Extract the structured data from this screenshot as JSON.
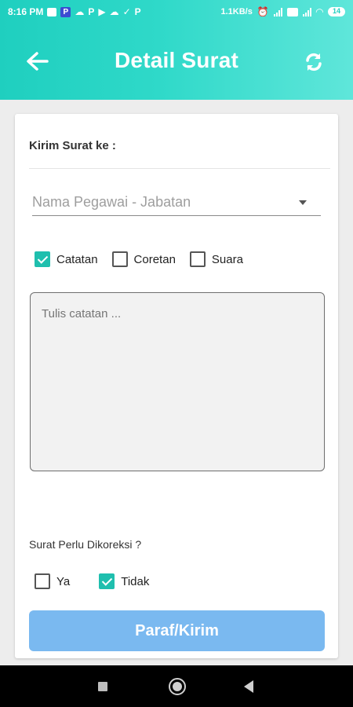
{
  "status_bar": {
    "time": "8:16 PM",
    "net_speed": "1.1KB/s",
    "battery": "14"
  },
  "app_bar": {
    "title": "Detail Surat",
    "back_icon": "arrow-left-icon",
    "refresh_icon": "refresh-icon"
  },
  "form": {
    "send_to_label": "Kirim Surat ke :",
    "recipient_dropdown": {
      "placeholder": "Nama Pegawai - Jabatan",
      "value": ""
    },
    "note_types": [
      {
        "label": "Catatan",
        "checked": true
      },
      {
        "label": "Coretan",
        "checked": false
      },
      {
        "label": "Suara",
        "checked": false
      }
    ],
    "note_input": {
      "placeholder": "Tulis catatan ...",
      "value": ""
    },
    "correction_label": "Surat Perlu Dikoreksi ?",
    "correction_options": [
      {
        "label": "Ya",
        "checked": false
      },
      {
        "label": "Tidak",
        "checked": true
      }
    ],
    "submit_label": "Paraf/Kirim"
  },
  "colors": {
    "accent": "#1fbfae",
    "header_gradient_start": "#1fcfbf",
    "header_gradient_end": "#5fe6da",
    "submit_button": "#7ab9f0"
  }
}
